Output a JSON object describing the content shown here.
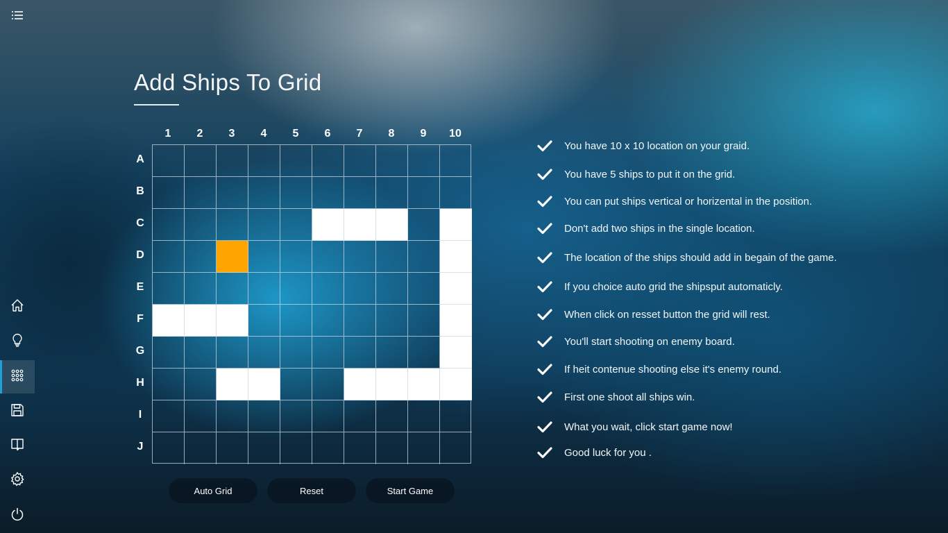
{
  "sidebar": {
    "items": [
      {
        "icon": "menu-icon"
      },
      {
        "icon": "home-icon"
      },
      {
        "icon": "lightbulb-icon"
      },
      {
        "icon": "grid-dots-icon",
        "active": true
      },
      {
        "icon": "save-icon"
      },
      {
        "icon": "book-icon"
      },
      {
        "icon": "settings-icon"
      },
      {
        "icon": "power-icon"
      }
    ]
  },
  "page": {
    "title": "Add Ships To Grid"
  },
  "grid": {
    "columns": [
      "1",
      "2",
      "3",
      "4",
      "5",
      "6",
      "7",
      "8",
      "9",
      "10"
    ],
    "rows": [
      "A",
      "B",
      "C",
      "D",
      "E",
      "F",
      "G",
      "H",
      "I",
      "J"
    ],
    "ship_cells": [
      "C6",
      "C7",
      "C8",
      "C10",
      "D10",
      "E10",
      "F10",
      "G10",
      "H10",
      "F1",
      "F2",
      "F3",
      "H3",
      "H4",
      "H7",
      "H8",
      "H9"
    ],
    "selected_cells": [
      "D3"
    ],
    "colors": {
      "ship": "#ffffff",
      "selected": "#ffa500"
    }
  },
  "buttons": {
    "auto_grid": "Auto Grid",
    "reset": "Reset",
    "start_game": "Start Game"
  },
  "rules": [
    "You have 10 x 10 location on your graid.",
    "You have 5 ships to put it on the grid.",
    "You can put ships vertical or horizental in the position.",
    "Don't add two ships in the single location.",
    "The location of the ships should add in begain of the game.",
    "If you choice auto grid the shipsput automaticly.",
    "When click on resset button the grid will rest.",
    "You'll start shooting on enemy board.",
    "If heit contenue shooting else it's enemy round.",
    "First one shoot all ships win.",
    "What you wait, click start game now!",
    "Good luck for you ."
  ]
}
